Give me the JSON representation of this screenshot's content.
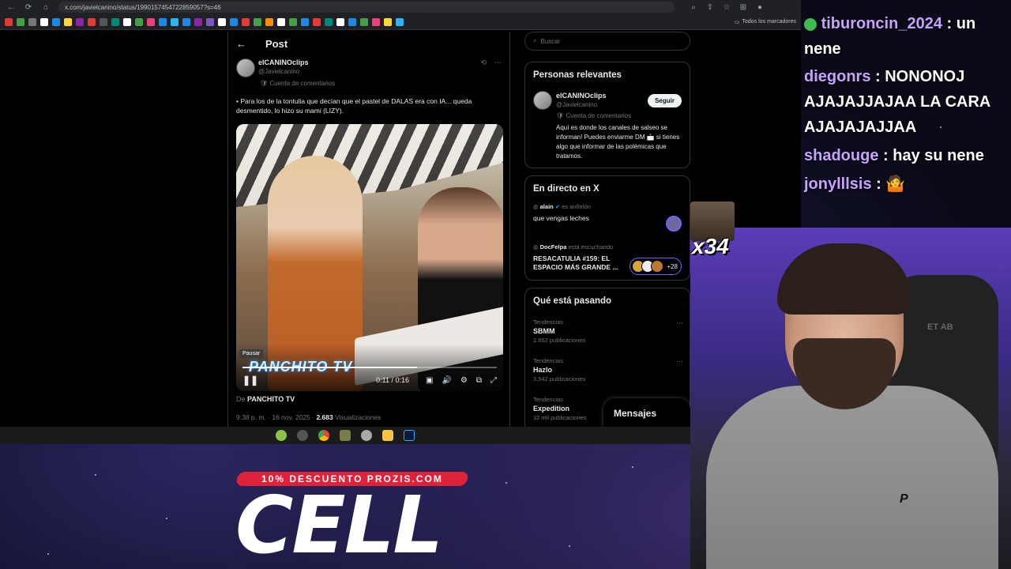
{
  "browser": {
    "url": "x.com/javielcanino/status/1990157454722859057?s=46",
    "bookmarks_folder": "Todos los marcadores",
    "nav_back": "←",
    "nav_forward": "→",
    "nav_reload": "⟳",
    "nav_home": "⌂"
  },
  "post": {
    "back_icon": "←",
    "header_title": "Post",
    "author_name": "elCANINOclips",
    "author_handle": "@Javielcanino",
    "author_badge": "Cuenta de comentarios",
    "text": "• Para los de la tontulia que decían que el pastel de DALAS era con IA... queda desmentido, lo hizo su mami (LIZY).",
    "video": {
      "watermark": "PANCHITO TV",
      "tooltip": "Pausar",
      "time": "0:11 / 0:16",
      "progress_fraction": 0.6875
    },
    "from_prefix": "De",
    "from_source": "PANCHITO TV",
    "timestamp": "9:38 p. m. · 16 nov. 2025 ·",
    "views_count": "2.683",
    "views_label": "Visualizaciones"
  },
  "sidebar": {
    "search_placeholder": "Buscar",
    "relevant": {
      "title": "Personas relevantes",
      "name": "elCANINOclips",
      "handle": "@Javielcanino",
      "badge": "Cuenta de comentarios",
      "bio": "Aquí es donde los canales de salseo se informan! Puedes enviarme DM 📩 si tienes algo que informar de las polémicas que tratamos.",
      "follow_label": "Seguir"
    },
    "live": {
      "title": "En directo en X",
      "items": [
        {
          "host": "alain",
          "role": "es anfitrión",
          "title": "que vengas leches"
        },
        {
          "host": "DocFelpa",
          "role": "está escuchando",
          "title": "RESACATULIA #159: EL ESPACIO MÁS GRANDE ...",
          "listeners": "+28"
        }
      ]
    },
    "trends": {
      "title": "Qué está pasando",
      "items": [
        {
          "category": "Tendencias",
          "name": "SBMM",
          "count": "2.662 publicaciones"
        },
        {
          "category": "Tendencias",
          "name": "Hazlo",
          "count": "3.542 publicaciones"
        },
        {
          "category": "Tendencias",
          "name": "Expedition",
          "count": "32 mil publicaciones"
        }
      ]
    },
    "messages_label": "Mensajes"
  },
  "chat": [
    {
      "user": "tiburoncin_2024",
      "sep": " : ",
      "message": "un nene"
    },
    {
      "user": "diegonrs",
      "sep": " : ",
      "message": "NONONOJ AJAJAJJAJAA LA CARA AJAJAJAJJAA"
    },
    {
      "user": "shadouge",
      "sep": " : ",
      "message": "hay su nene"
    },
    {
      "user": "jonylllsis",
      "sep": " : ",
      "message": "🤷"
    }
  ],
  "overlay": {
    "emote_count": "x34",
    "promo": "10% DESCUENTO PROZIS.COM",
    "brand": "CELL",
    "chair_logo": "ET AB",
    "hoodie_logo": "P"
  },
  "colors": {
    "x_bg": "#000000",
    "chat_user": "#c8a2ff",
    "promo_red": "#e0213a"
  }
}
